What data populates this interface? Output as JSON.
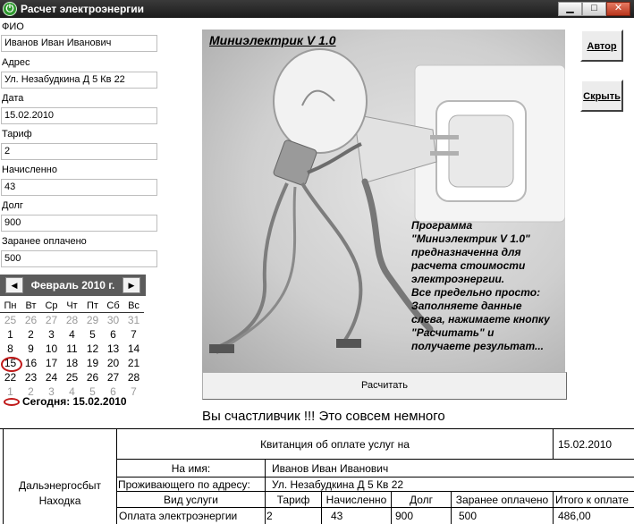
{
  "window": {
    "title": "Расчет электроэнергии",
    "controls": {
      "minimize": "▁",
      "maximize": "□",
      "close": "✕"
    }
  },
  "form": {
    "fio": {
      "label": "ФИО",
      "value": "Иванов Иван Иванович"
    },
    "address": {
      "label": "Адрес",
      "value": "Ул. Незабудкина Д 5 Кв 22"
    },
    "date": {
      "label": "Дата",
      "value": "15.02.2010"
    },
    "tariff": {
      "label": "Тариф",
      "value": "2"
    },
    "accrued": {
      "label": "Начисленно",
      "value": "43"
    },
    "debt": {
      "label": "Долг",
      "value": "900"
    },
    "prepaid": {
      "label": "Заранее оплачено",
      "value": "500"
    }
  },
  "calendar": {
    "month_label": "Февраль 2010 г.",
    "prev": "◀",
    "next": "▶",
    "weekdays": [
      "Пн",
      "Вт",
      "Ср",
      "Чт",
      "Пт",
      "Сб",
      "Вс"
    ],
    "weeks": [
      [
        "25",
        "26",
        "27",
        "28",
        "29",
        "30",
        "31"
      ],
      [
        "1",
        "2",
        "3",
        "4",
        "5",
        "6",
        "7"
      ],
      [
        "8",
        "9",
        "10",
        "11",
        "12",
        "13",
        "14"
      ],
      [
        "15",
        "16",
        "17",
        "18",
        "19",
        "20",
        "21"
      ],
      [
        "22",
        "23",
        "24",
        "25",
        "26",
        "27",
        "28"
      ],
      [
        "1",
        "2",
        "3",
        "4",
        "5",
        "6",
        "7"
      ]
    ],
    "today_label": "Сегодня: 15.02.2010"
  },
  "picture": {
    "title": "Миниэлектрик V 1.0",
    "description": "Программа\n\"Миниэлектрик V 1.0\"\nпредназначенна для\nрасчета стоимости\nэлектроэнергии.\nВсе предельно просто:\nЗаполняете данные\nслева, нажимаете кнопку\n\"Расчитать\" и\nполучаете результат..."
  },
  "buttons": {
    "author": "Автор",
    "hide": "Скрыть",
    "calculate": "Расчитать"
  },
  "message": "Вы счастливчик !!! Это совсем немного",
  "receipt": {
    "company": "Дальэнергосбыт\nНаходка",
    "title": "Квитанция об оплате услуг на",
    "date": "15.02.2010",
    "name_label": "На имя:",
    "name_value": "Иванов Иван Иванович",
    "address_label": "Проживающего по адресу:",
    "address_value": "Ул. Незабудкина Д 5 Кв 22",
    "columns": [
      "Вид услуги",
      "Тариф",
      "Начисленно",
      "Долг",
      "Заранее оплачено",
      "Итого к оплате"
    ],
    "row": [
      "Оплата электроэнергии",
      "2",
      "43",
      "900",
      "500",
      "486,00"
    ]
  }
}
